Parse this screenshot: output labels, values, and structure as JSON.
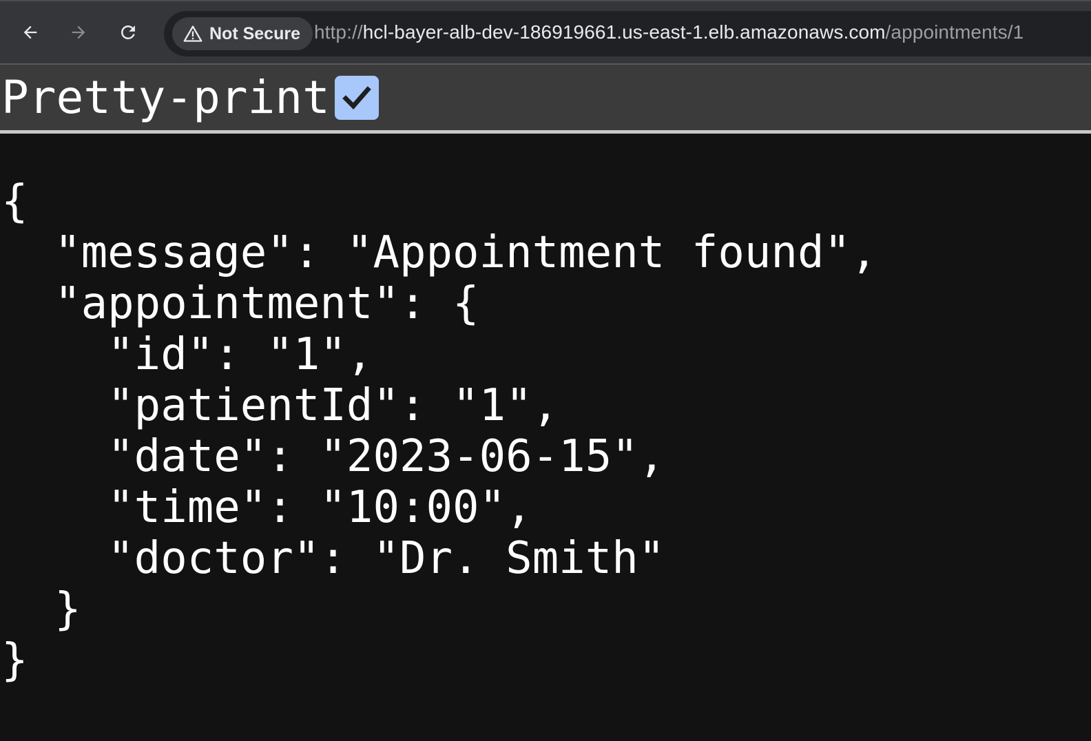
{
  "browser": {
    "security_label": "Not Secure",
    "url": {
      "scheme": "http://",
      "host": "hcl-bayer-alb-dev-186919661.us-east-1.elb.amazonaws.com",
      "path": "/appointments/1"
    },
    "icons": [
      "back-arrow-icon",
      "forward-arrow-icon",
      "reload-icon",
      "warning-triangle-icon"
    ]
  },
  "pretty_print": {
    "label": "Pretty-print",
    "checked": true
  },
  "json_lines": [
    "{",
    "  \"message\": \"Appointment found\",",
    "  \"appointment\": {",
    "    \"id\": \"1\",",
    "    \"patientId\": \"1\",",
    "    \"date\": \"2023-06-15\",",
    "    \"time\": \"10:00\",",
    "    \"doctor\": \"Dr. Smith\"",
    "  }",
    "}"
  ],
  "colors": {
    "toolbar": "#35363a",
    "omnibox": "#202124",
    "checkbox": "#a8c7fa",
    "page_background": "#121212",
    "text": "#ffffff"
  }
}
